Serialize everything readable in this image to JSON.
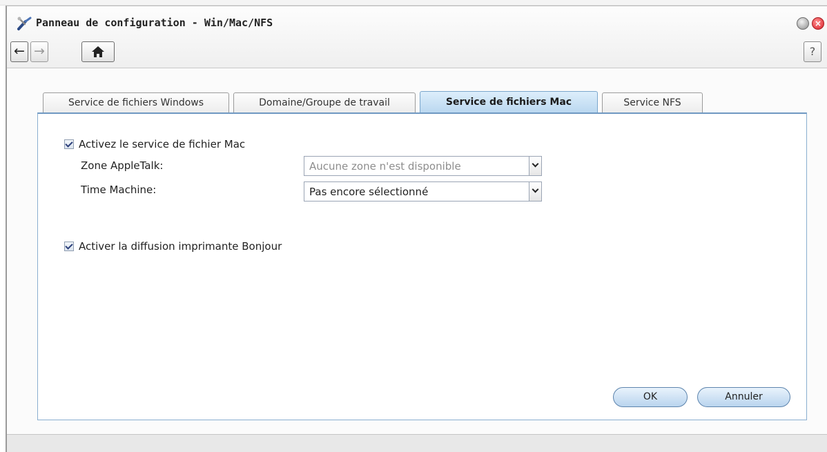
{
  "window": {
    "title": "Panneau de configuration - Win/Mac/NFS",
    "app_icon": "tools-icon"
  },
  "toolbar": {
    "back_icon": "←",
    "forward_icon": "→",
    "home_icon": "🏠",
    "help_label": "?"
  },
  "tabs": [
    {
      "label": "Service de fichiers Windows",
      "active": false
    },
    {
      "label": "Domaine/Groupe de travail",
      "active": false
    },
    {
      "label": "Service de fichiers Mac",
      "active": true
    },
    {
      "label": "Service NFS",
      "active": false
    }
  ],
  "form": {
    "enable_mac_label": "Activez le service de fichier Mac",
    "enable_mac_checked": true,
    "appletalk_label": "Zone AppleTalk:",
    "appletalk_value": "Aucune zone n'est disponible",
    "timemachine_label": "Time Machine:",
    "timemachine_value": "Pas encore sélectionné",
    "bonjour_label": "Activer la diffusion imprimante Bonjour",
    "bonjour_checked": true
  },
  "buttons": {
    "ok": "OK",
    "cancel": "Annuler"
  },
  "colors": {
    "accent": "#6f98c2",
    "active_tab": "#b8d6ef",
    "close_button": "#d9202a"
  }
}
